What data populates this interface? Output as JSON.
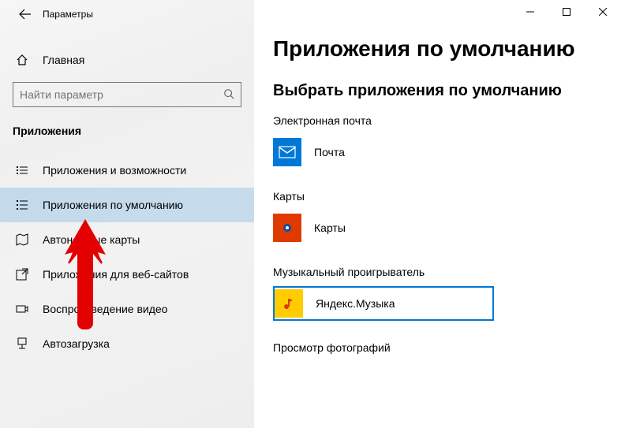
{
  "window": {
    "title": "Параметры"
  },
  "sidebar": {
    "home_label": "Главная",
    "search_placeholder": "Найти параметр",
    "section_heading": "Приложения",
    "items": [
      {
        "label": "Приложения и возможности"
      },
      {
        "label": "Приложения по умолчанию"
      },
      {
        "label": "Автономные карты"
      },
      {
        "label": "Приложения для веб-сайтов"
      },
      {
        "label": "Воспроизведение видео"
      },
      {
        "label": "Автозагрузка"
      }
    ]
  },
  "content": {
    "page_title": "Приложения по умолчанию",
    "sub_title": "Выбрать приложения по умолчанию",
    "categories": [
      {
        "label": "Электронная почта",
        "app_name": "Почта"
      },
      {
        "label": "Карты",
        "app_name": "Карты"
      },
      {
        "label": "Музыкальный проигрыватель",
        "app_name": "Яндекс.Музыка"
      },
      {
        "label": "Просмотр фотографий",
        "app_name": ""
      }
    ]
  },
  "annotation": {
    "arrow_target": "Приложения по умолчанию"
  }
}
